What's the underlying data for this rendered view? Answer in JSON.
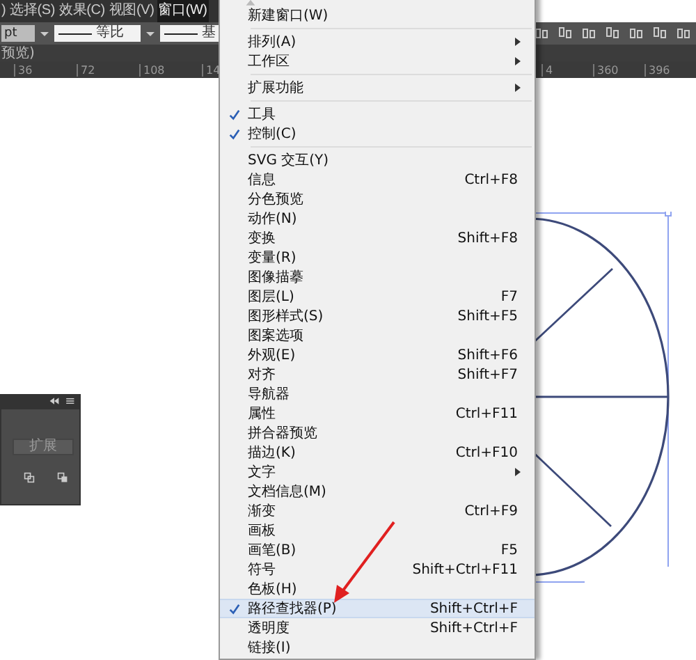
{
  "menu_bar": [
    {
      "label": ")",
      "selected": false
    },
    {
      "label": "选择(S)",
      "selected": false
    },
    {
      "label": "效果(C)",
      "selected": false
    },
    {
      "label": "视图(V)",
      "selected": false
    },
    {
      "label": "窗口(W)",
      "selected": true
    }
  ],
  "control_bar": {
    "unit_field": "pt",
    "profile_field": "等比",
    "brush_field": "基"
  },
  "document_tab": "预览)",
  "ruler": {
    "left_ticks": [
      "36",
      "72",
      "108",
      "14"
    ],
    "right_ticks": [
      "4",
      "360",
      "396"
    ]
  },
  "floating_panel": {
    "button": "扩展"
  },
  "window_menu": {
    "groups": [
      [
        {
          "label": "新建窗口(W)",
          "submenu": false,
          "checked": false,
          "selected": false
        }
      ],
      [
        {
          "label": "排列(A)",
          "submenu": true,
          "checked": false,
          "selected": false
        },
        {
          "label": "工作区",
          "submenu": true,
          "checked": false,
          "selected": false
        }
      ],
      [
        {
          "label": "扩展功能",
          "submenu": true,
          "checked": false,
          "selected": false
        }
      ],
      [
        {
          "label": "工具",
          "submenu": false,
          "checked": true,
          "selected": false
        },
        {
          "label": "控制(C)",
          "submenu": false,
          "checked": true,
          "selected": false
        }
      ],
      [
        {
          "label": "SVG 交互(Y)",
          "submenu": false,
          "checked": false,
          "selected": false
        },
        {
          "label": "信息",
          "shortcut": "Ctrl+F8",
          "submenu": false,
          "checked": false,
          "selected": false
        },
        {
          "label": "分色预览",
          "submenu": false,
          "checked": false,
          "selected": false
        },
        {
          "label": "动作(N)",
          "submenu": false,
          "checked": false,
          "selected": false
        },
        {
          "label": "变换",
          "shortcut": "Shift+F8",
          "submenu": false,
          "checked": false,
          "selected": false
        },
        {
          "label": "变量(R)",
          "submenu": false,
          "checked": false,
          "selected": false
        },
        {
          "label": "图像描摹",
          "submenu": false,
          "checked": false,
          "selected": false
        },
        {
          "label": "图层(L)",
          "shortcut": "F7",
          "submenu": false,
          "checked": false,
          "selected": false
        },
        {
          "label": "图形样式(S)",
          "shortcut": "Shift+F5",
          "submenu": false,
          "checked": false,
          "selected": false
        },
        {
          "label": "图案选项",
          "submenu": false,
          "checked": false,
          "selected": false
        },
        {
          "label": "外观(E)",
          "shortcut": "Shift+F6",
          "submenu": false,
          "checked": false,
          "selected": false
        },
        {
          "label": "对齐",
          "shortcut": "Shift+F7",
          "submenu": false,
          "checked": false,
          "selected": false
        },
        {
          "label": "导航器",
          "submenu": false,
          "checked": false,
          "selected": false
        },
        {
          "label": "属性",
          "shortcut": "Ctrl+F11",
          "submenu": false,
          "checked": false,
          "selected": false
        },
        {
          "label": "拼合器预览",
          "submenu": false,
          "checked": false,
          "selected": false
        },
        {
          "label": "描边(K)",
          "shortcut": "Ctrl+F10",
          "submenu": false,
          "checked": false,
          "selected": false
        },
        {
          "label": "文字",
          "submenu": true,
          "checked": false,
          "selected": false
        },
        {
          "label": "文档信息(M)",
          "submenu": false,
          "checked": false,
          "selected": false
        },
        {
          "label": "渐变",
          "shortcut": "Ctrl+F9",
          "submenu": false,
          "checked": false,
          "selected": false
        },
        {
          "label": "画板",
          "submenu": false,
          "checked": false,
          "selected": false
        },
        {
          "label": "画笔(B)",
          "shortcut": "F5",
          "submenu": false,
          "checked": false,
          "selected": false
        },
        {
          "label": "符号",
          "shortcut": "Shift+Ctrl+F11",
          "submenu": false,
          "checked": false,
          "selected": false
        },
        {
          "label": "色板(H)",
          "submenu": false,
          "checked": false,
          "selected": false
        },
        {
          "label": "路径查找器(P)",
          "shortcut": "Shift+Ctrl+F",
          "submenu": false,
          "checked": true,
          "selected": true
        },
        {
          "label": "透明度",
          "shortcut": "Shift+Ctrl+F",
          "submenu": false,
          "checked": false,
          "selected": false
        },
        {
          "label": "链接(I)",
          "submenu": false,
          "checked": false,
          "selected": false
        }
      ]
    ]
  }
}
